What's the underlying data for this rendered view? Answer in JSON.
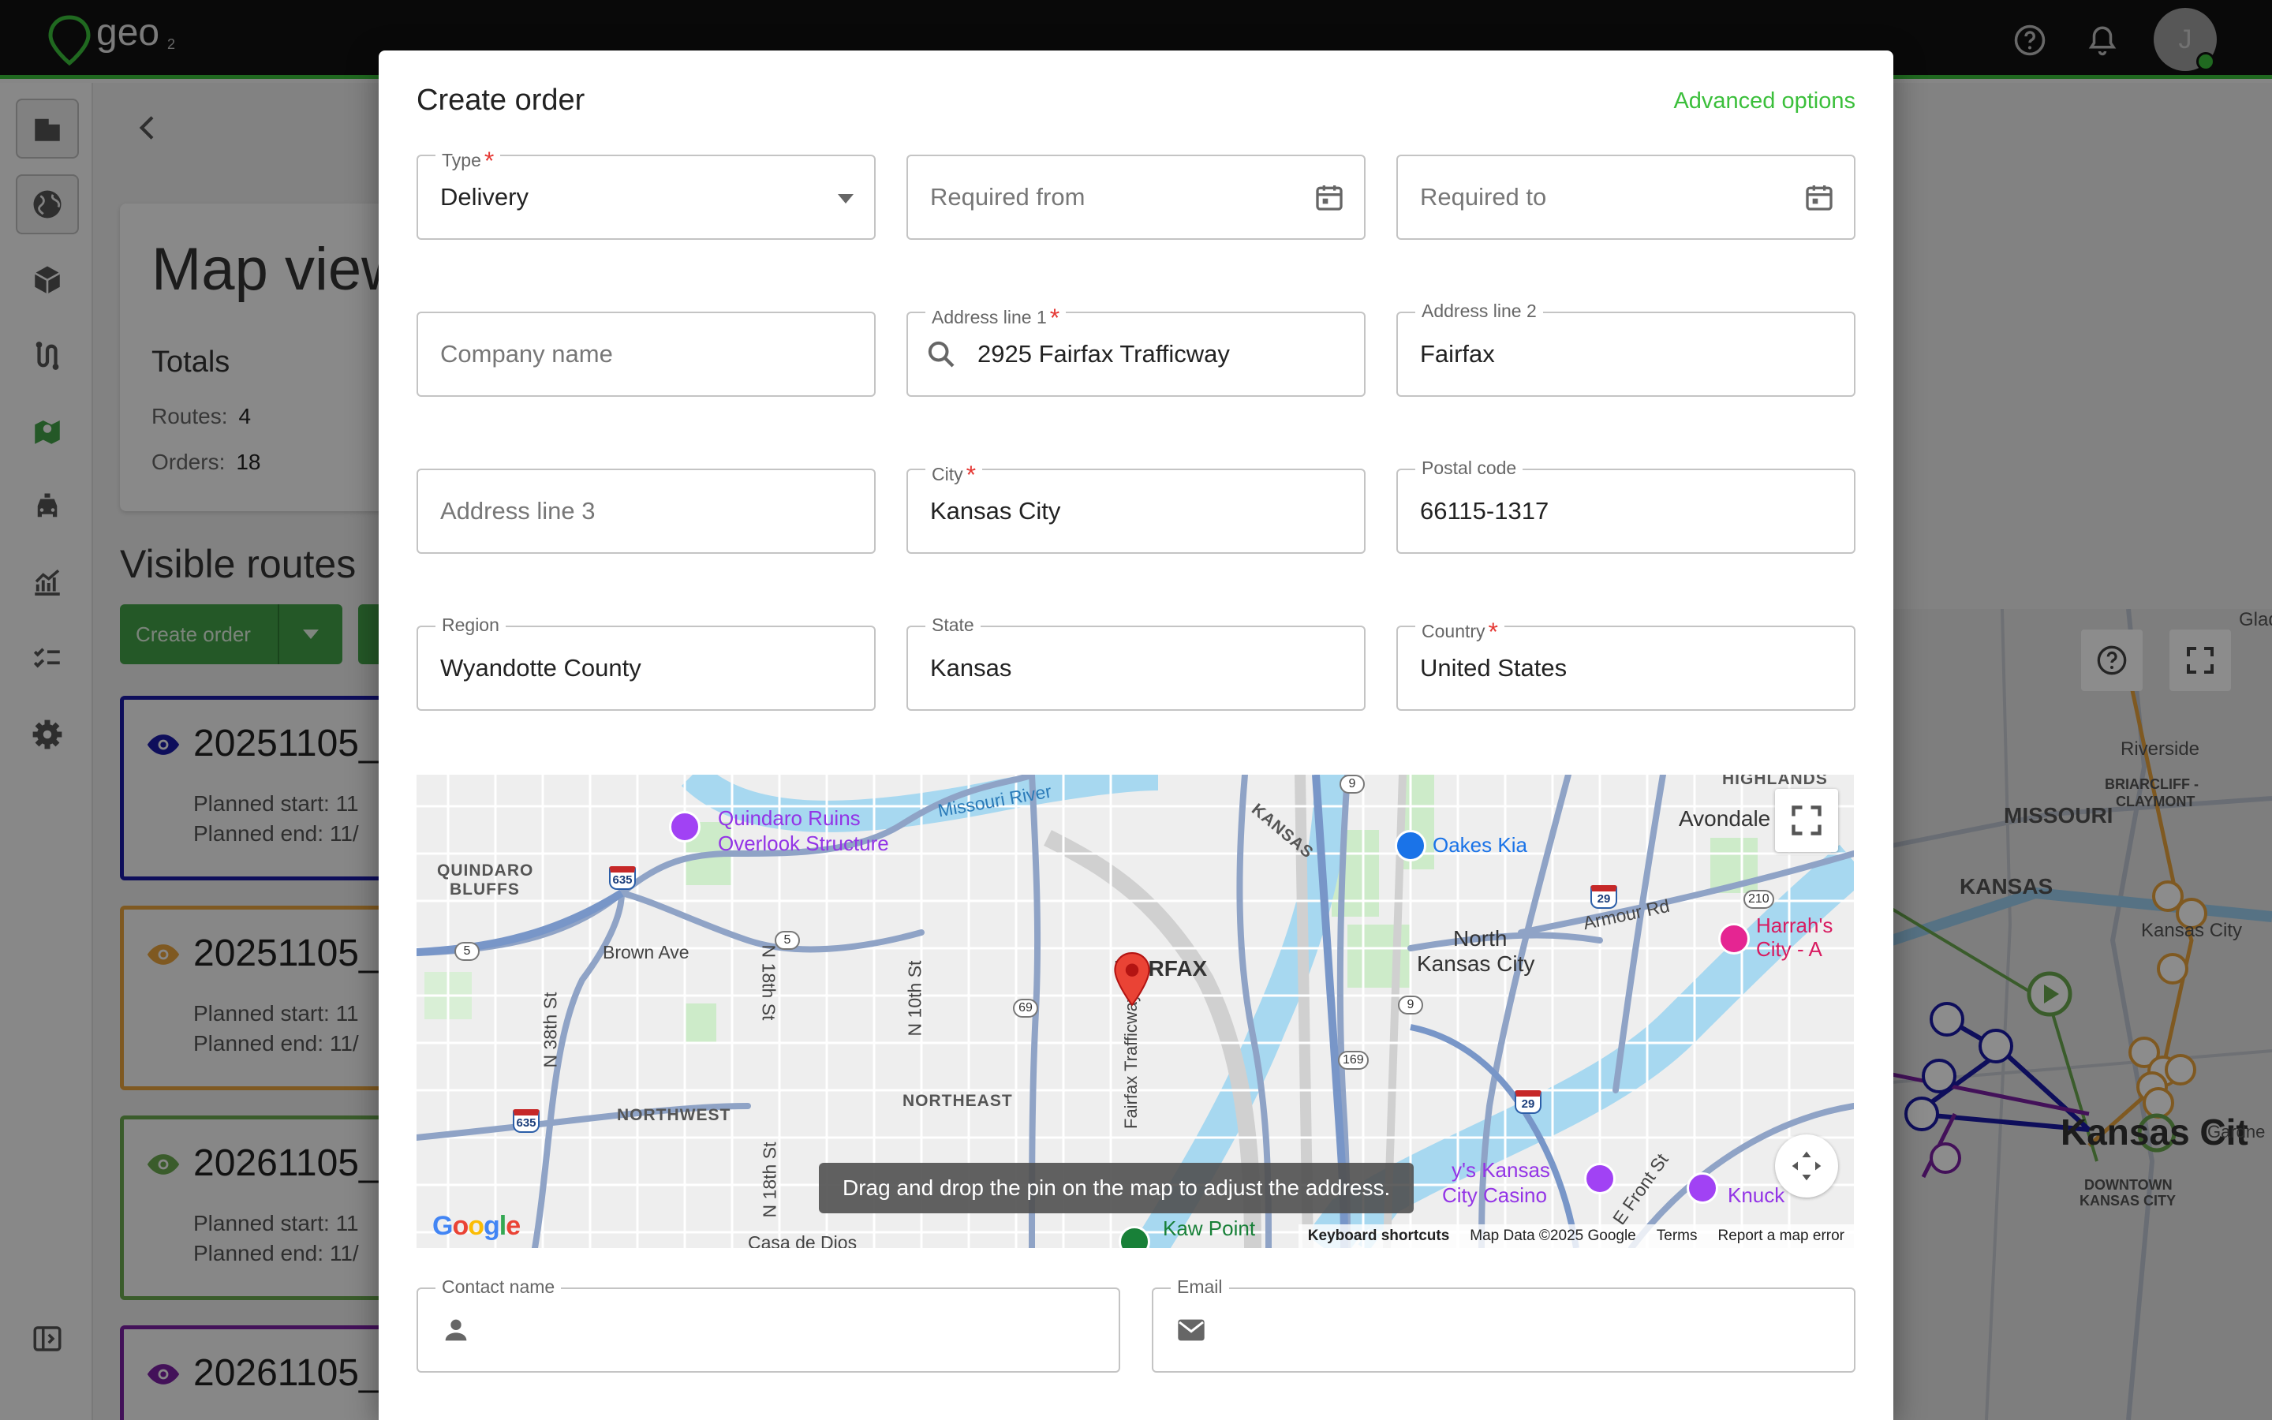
{
  "app": {
    "logo_text": "geo",
    "logo_sub": "2",
    "avatar_initial": "J",
    "accent": "#3bbf3b"
  },
  "topbar": {
    "help_icon": "help-circle-icon",
    "notification_icon": "bell-icon"
  },
  "rail": {
    "items": [
      "building-icon",
      "globe-icon",
      "package-icon",
      "route-icon",
      "map-icon",
      "vehicle-icon",
      "analytics-icon",
      "checklist-icon",
      "settings-icon"
    ],
    "collapse_icon": "sidebar-collapse-icon"
  },
  "background": {
    "map_view_title": "Map view",
    "totals_label": "Totals",
    "routes_label": "Routes:",
    "routes_value": "4",
    "orders_label": "Orders:",
    "orders_value": "18",
    "visible_routes_title": "Visible routes",
    "create_order_button": "Create order",
    "routes": [
      {
        "title": "20251105_",
        "start_label": "Planned start:",
        "start_value": "11",
        "end_label": "Planned end:",
        "end_value": "11/",
        "color": "#1a1aa6"
      },
      {
        "title": "20251105_",
        "start_label": "Planned start:",
        "start_value": "11",
        "end_label": "Planned end:",
        "end_value": "11/",
        "color": "#e8a33d"
      },
      {
        "title": "20261105_",
        "start_label": "Planned start:",
        "start_value": "11",
        "end_label": "Planned end:",
        "end_value": "11/",
        "color": "#6aa84f"
      },
      {
        "title": "20261105_",
        "color": "#7b1fa2"
      }
    ],
    "map_labels": {
      "riverside": "Riverside",
      "missouri": "MISSOURI",
      "kansas": "KANSAS",
      "briarcliff": "BRIARCLIFF -",
      "claymont": "CLAYMONT",
      "kansas_city_short": "Kansas City",
      "kansas_city_big": "Kansas Cit",
      "downtown": "DOWNTOWN",
      "downtown2": "KANSAS CITY",
      "gladstone": "Glad",
      "gardner": "Gardne"
    }
  },
  "dialog": {
    "title": "Create order",
    "advanced_options": "Advanced options",
    "type": {
      "label": "Type",
      "value": "Delivery"
    },
    "required_from": {
      "placeholder": "Required from"
    },
    "required_to": {
      "placeholder": "Required to"
    },
    "company_name": {
      "placeholder": "Company name"
    },
    "address_line_1": {
      "label": "Address line 1",
      "value": "2925 Fairfax Trafficway"
    },
    "address_line_2": {
      "label": "Address line 2",
      "value": "Fairfax"
    },
    "address_line_3": {
      "placeholder": "Address line 3"
    },
    "city": {
      "label": "City",
      "value": "Kansas City"
    },
    "postal_code": {
      "label": "Postal code",
      "value": "66115-1317"
    },
    "region": {
      "label": "Region",
      "value": "Wyandotte County"
    },
    "state": {
      "label": "State",
      "value": "Kansas"
    },
    "country": {
      "label": "Country",
      "value": "United States"
    },
    "contact_name": {
      "label": "Contact name",
      "value": ""
    },
    "email": {
      "label": "Email",
      "value": ""
    },
    "required_marker": "*"
  },
  "map": {
    "tooltip": "Drag and drop the pin on the map to adjust the address.",
    "attribution": {
      "keyboard": "Keyboard shortcuts",
      "data": "Map Data ©2025 Google",
      "terms": "Terms",
      "report": "Report a map error"
    },
    "google_logo": "Google",
    "labels": {
      "quindaro1": "Quindaro Ruins",
      "quindaro2": "Overlook Structure",
      "missouri_river": "Missouri River",
      "kansas_river": "KANSAS",
      "oakes": "Oakes Kia",
      "highlands": "HIGHLANDS",
      "avondale": "Avondale",
      "quindaro_bluffs1": "QUINDARO",
      "quindaro_bluffs2": "BLUFFS",
      "brown_ave": "Brown Ave",
      "n18": "N 18th St",
      "n10": "N 10th St",
      "n38": "N 38th St",
      "fairfax": "FAIRFAX",
      "fairfax_tfwy": "Fairfax Trafficway",
      "northwest": "NORTHWEST",
      "northeast": "NORTHEAST",
      "nkc1": "North",
      "nkc2": "Kansas City",
      "armour": "Armour Rd",
      "harrahs1": "Harrah's",
      "harrahs2": "City - A",
      "casino1": "y's Kansas",
      "casino2": "City Casino",
      "kaw": "Kaw Point",
      "knuck": "Knuck",
      "efront": "E Front St",
      "casa": "Casa de Dios",
      "n18b": "N 18th St",
      "shield_5a": "5",
      "shield_5b": "5",
      "shield_9a": "9",
      "shield_9b": "9",
      "shield_69": "69",
      "shield_169": "169",
      "shield_210": "210",
      "i635a": "635",
      "i635b": "635",
      "i29a": "29",
      "i29b": "29"
    }
  }
}
